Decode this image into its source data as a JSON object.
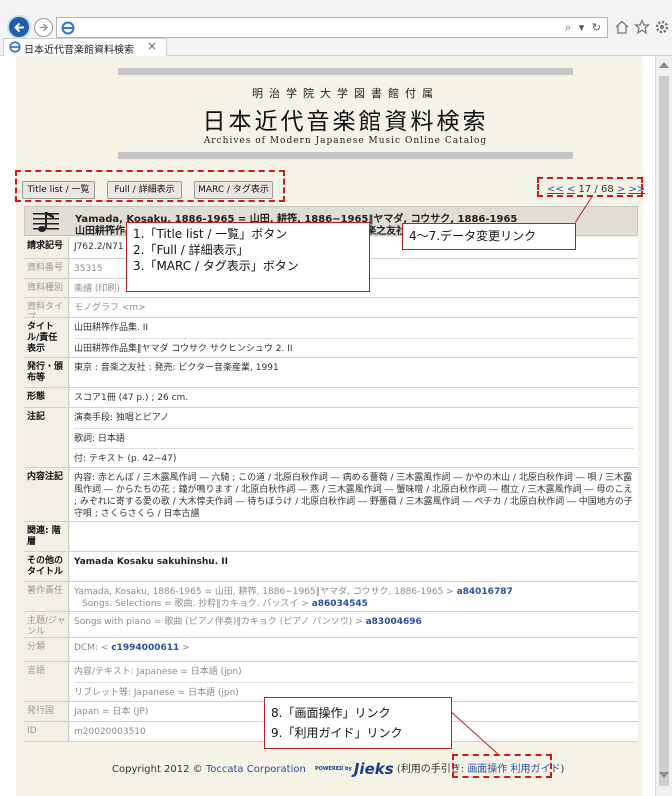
{
  "browser": {
    "address_actions": "⌕ ▾ ↻",
    "tab_title": "日本近代音楽館資料検索",
    "tab_close": "×"
  },
  "header": {
    "subtitle": "明治学院大学図書館付属",
    "title": "日本近代音楽館資料検索",
    "english": "Archives of Modern Japanese Music Online Catalog"
  },
  "toolbar": {
    "title_list": "Title list / 一覧",
    "full": "Full / 詳細表示",
    "marc": "MARC / タグ表示"
  },
  "pager": {
    "first": "<<",
    "prev": "<",
    "position": "17 / 68",
    "next": ">",
    "last": ">>"
  },
  "record_header": {
    "line1": "Yamada, Kosaku, 1886-1965 = 山田, 耕筰, 1886−1965‖ヤマダ, コウサク, 1886-1965",
    "line2": "山田耕筰作品集‖ヤマダ コウサク サクヒンシュウ 2. II 東京 : 音楽之友社"
  },
  "fields": {
    "call_no": {
      "label": "請求記号",
      "value": "J762.2/N71"
    },
    "item_no": {
      "label": "資料番号",
      "value": "35315"
    },
    "item_kind": {
      "label": "資料種別",
      "value": "楽譜 (印刷)"
    },
    "item_type": {
      "label": "資料タイプ",
      "value": "モノグラフ <m>"
    },
    "title": {
      "label": "タイトル/責任表示",
      "value": "山田耕筰作品集. II",
      "value2": "山田耕筰作品集‖ヤマダ コウサク サクヒンシュウ 2. II"
    },
    "publication": {
      "label": "発行・頒布等",
      "value": "東京 : 音楽之友社 : 発売: ビクター音楽産業, 1991"
    },
    "form": {
      "label": "形態",
      "value": "スコア1冊 (47 p.) ; 26 cm."
    },
    "notes": {
      "label": "注記",
      "value1": "演奏手段: 独唱とピアノ",
      "value2": "歌詞: 日本語",
      "value3": "付: テキスト (p. 42−47)"
    },
    "contents": {
      "label": "内容注記",
      "value": "内容: 赤とんぼ / 三木露風作詞 ― 六騎 ; この道 / 北原白秋作詞 ― 病める薔薇 / 三木露風作詞 ― かやの木山 / 北原白秋作詞 ― 唄 / 三木露風作詞 ― からたちの花 ; 鐘が鳴ります / 北原白秋作詞 ― 燕 / 三木露風作詞 ― 蟹味噌 / 北原白秋作詞 ― 樹立 / 三木露風作詞 ― 母のこえ ; みぞれに寄する愛の歌 / 大木惇夫作詞 ― 待ちぼうけ / 北原白秋作詞 ― 野薔薇 / 三木露風作詞 ― ペチカ / 北原白秋作詞 ― 中国地方の子守唄 ; さくらさくら / 日本古譜"
    },
    "related": {
      "label": "関連: 階層",
      "value": ""
    },
    "other_title": {
      "label": "その他のタイトル",
      "value": "Yamada Kosaku sakuhinshu. II"
    },
    "author": {
      "label": "著作責任",
      "value1": "Yamada, Kosaku, 1886-1965 = 山田, 耕筰, 1886−1965‖ヤマダ, コウサク, 1886-1965 >",
      "link1": "a84016787",
      "value2": "Songs. Selections = 歌曲. 抄粋‖カキョク. バッスイ >",
      "link2": "a86034545"
    },
    "subject": {
      "label": "主題/ジャンル",
      "value": "Songs with piano = 歌曲 (ピアノ伴奏)‖カキョク (ピアノ バンソウ) >",
      "link": "a83004696"
    },
    "classification": {
      "label": "分類",
      "value": "DCM: <",
      "link": "c1994000611",
      "value_end": ">"
    },
    "language": {
      "label": "言語",
      "value1": "内容/テキスト: Japanese = 日本語 (jpn)",
      "value2": "リブレット等: Japanese = 日本語 (jpn)"
    },
    "country": {
      "label": "発行国",
      "value": "Japan = 日本 (JP)"
    },
    "id": {
      "label": "ID",
      "value": "m20020003510"
    }
  },
  "footer": {
    "copyright": "Copyright 2012 ©",
    "company": "Toccata Corporation",
    "powered": "POWERED by",
    "brand": "Jieks",
    "guide_prefix": "(利用の手引き:",
    "screen_ops": "画面操作",
    "usage_guide": "利用ガイド",
    "guide_suffix": ")"
  },
  "annotations": {
    "buttons_note": [
      "1.「Title list / 一覧」ボタン",
      "2.「Full / 詳細表示」",
      "3.「MARC / タグ表示」ボタン"
    ],
    "pager_note": "4〜7.データ変更リンク",
    "footer_note": [
      "8.「画面操作」リンク",
      "9.「利用ガイド」リンク"
    ],
    "color": "#d21919"
  }
}
